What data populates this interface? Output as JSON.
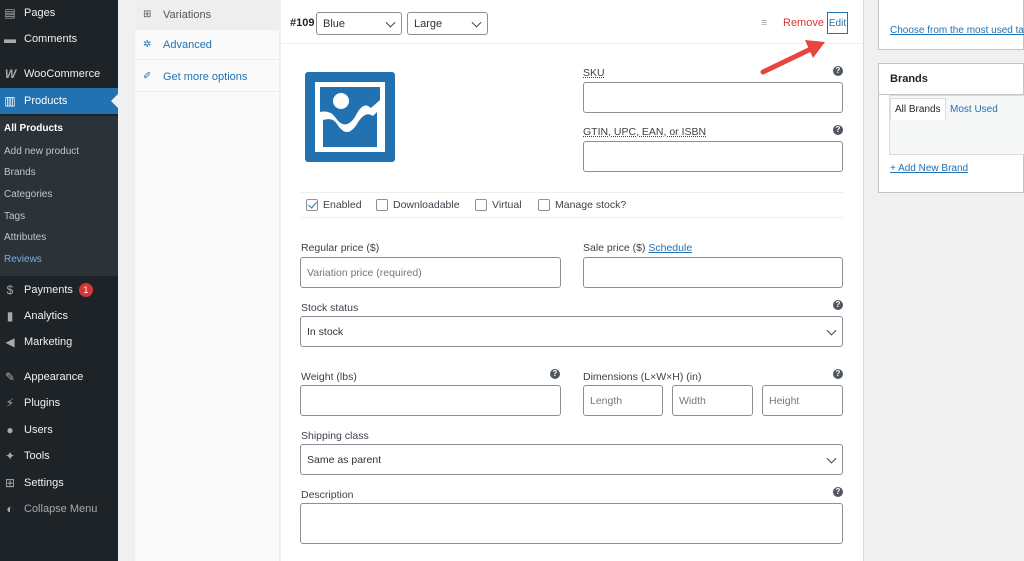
{
  "sidebar": {
    "items": [
      {
        "label": "Pages",
        "icon": "pages-icon",
        "glyph": "▤"
      },
      {
        "label": "Comments",
        "icon": "comments-icon",
        "glyph": "▬"
      },
      {
        "label": "WooCommerce",
        "icon": "woocommerce-icon",
        "glyph": "W"
      },
      {
        "label": "Products",
        "icon": "products-icon",
        "glyph": "▥"
      },
      {
        "label": "Payments",
        "icon": "payments-icon",
        "glyph": "$",
        "badge": "1"
      },
      {
        "label": "Analytics",
        "icon": "analytics-icon",
        "glyph": "▮"
      },
      {
        "label": "Marketing",
        "icon": "marketing-icon",
        "glyph": "◀"
      },
      {
        "label": "Appearance",
        "icon": "appearance-icon",
        "glyph": "✎"
      },
      {
        "label": "Plugins",
        "icon": "plugins-icon",
        "glyph": "⚡"
      },
      {
        "label": "Users",
        "icon": "users-icon",
        "glyph": "●"
      },
      {
        "label": "Tools",
        "icon": "tools-icon",
        "glyph": "✦"
      },
      {
        "label": "Settings",
        "icon": "settings-icon",
        "glyph": "⊞"
      },
      {
        "label": "Collapse Menu",
        "icon": "collapse-icon",
        "glyph": "◐"
      }
    ],
    "submenu": [
      "All Products",
      "Add new product",
      "Brands",
      "Categories",
      "Tags",
      "Attributes",
      "Reviews"
    ]
  },
  "tabs": [
    {
      "label": "Variations",
      "icon": "grid-icon",
      "glyph": "⊞"
    },
    {
      "label": "Advanced",
      "icon": "gear-icon",
      "glyph": "✲"
    },
    {
      "label": "Get more options",
      "icon": "plugin-icon",
      "glyph": "✐"
    }
  ],
  "variation": {
    "id": "#109",
    "color": "Blue",
    "size": "Large",
    "remove_label": "Remove",
    "edit_label": "Edit",
    "sku_label": "SKU",
    "gtin_label": "GTIN, UPC, EAN, or ISBN",
    "checkboxes": [
      {
        "label": "Enabled",
        "checked": true
      },
      {
        "label": "Downloadable",
        "checked": false
      },
      {
        "label": "Virtual",
        "checked": false
      },
      {
        "label": "Manage stock?",
        "checked": false
      }
    ],
    "regular_price_label": "Regular price ($)",
    "regular_price_placeholder": "Variation price (required)",
    "sale_price_label": "Sale price ($)",
    "schedule_link": "Schedule",
    "stock_status_label": "Stock status",
    "stock_status_value": "In stock",
    "weight_label": "Weight (lbs)",
    "dimensions_label": "Dimensions (L×W×H) (in)",
    "length_placeholder": "Length",
    "width_placeholder": "Width",
    "height_placeholder": "Height",
    "shipping_label": "Shipping class",
    "shipping_value": "Same as parent",
    "description_label": "Description",
    "help_glyph": "?"
  },
  "right": {
    "most_used_link": "Choose from the most used ta",
    "brands_title": "Brands",
    "tab_all": "All Brands",
    "tab_most": "Most Used",
    "add_new": "+ Add New Brand"
  },
  "colors": {
    "accent": "#2271b1",
    "sidebar": "#1d2327",
    "remove": "#d63638",
    "arrow": "#e8453c"
  }
}
